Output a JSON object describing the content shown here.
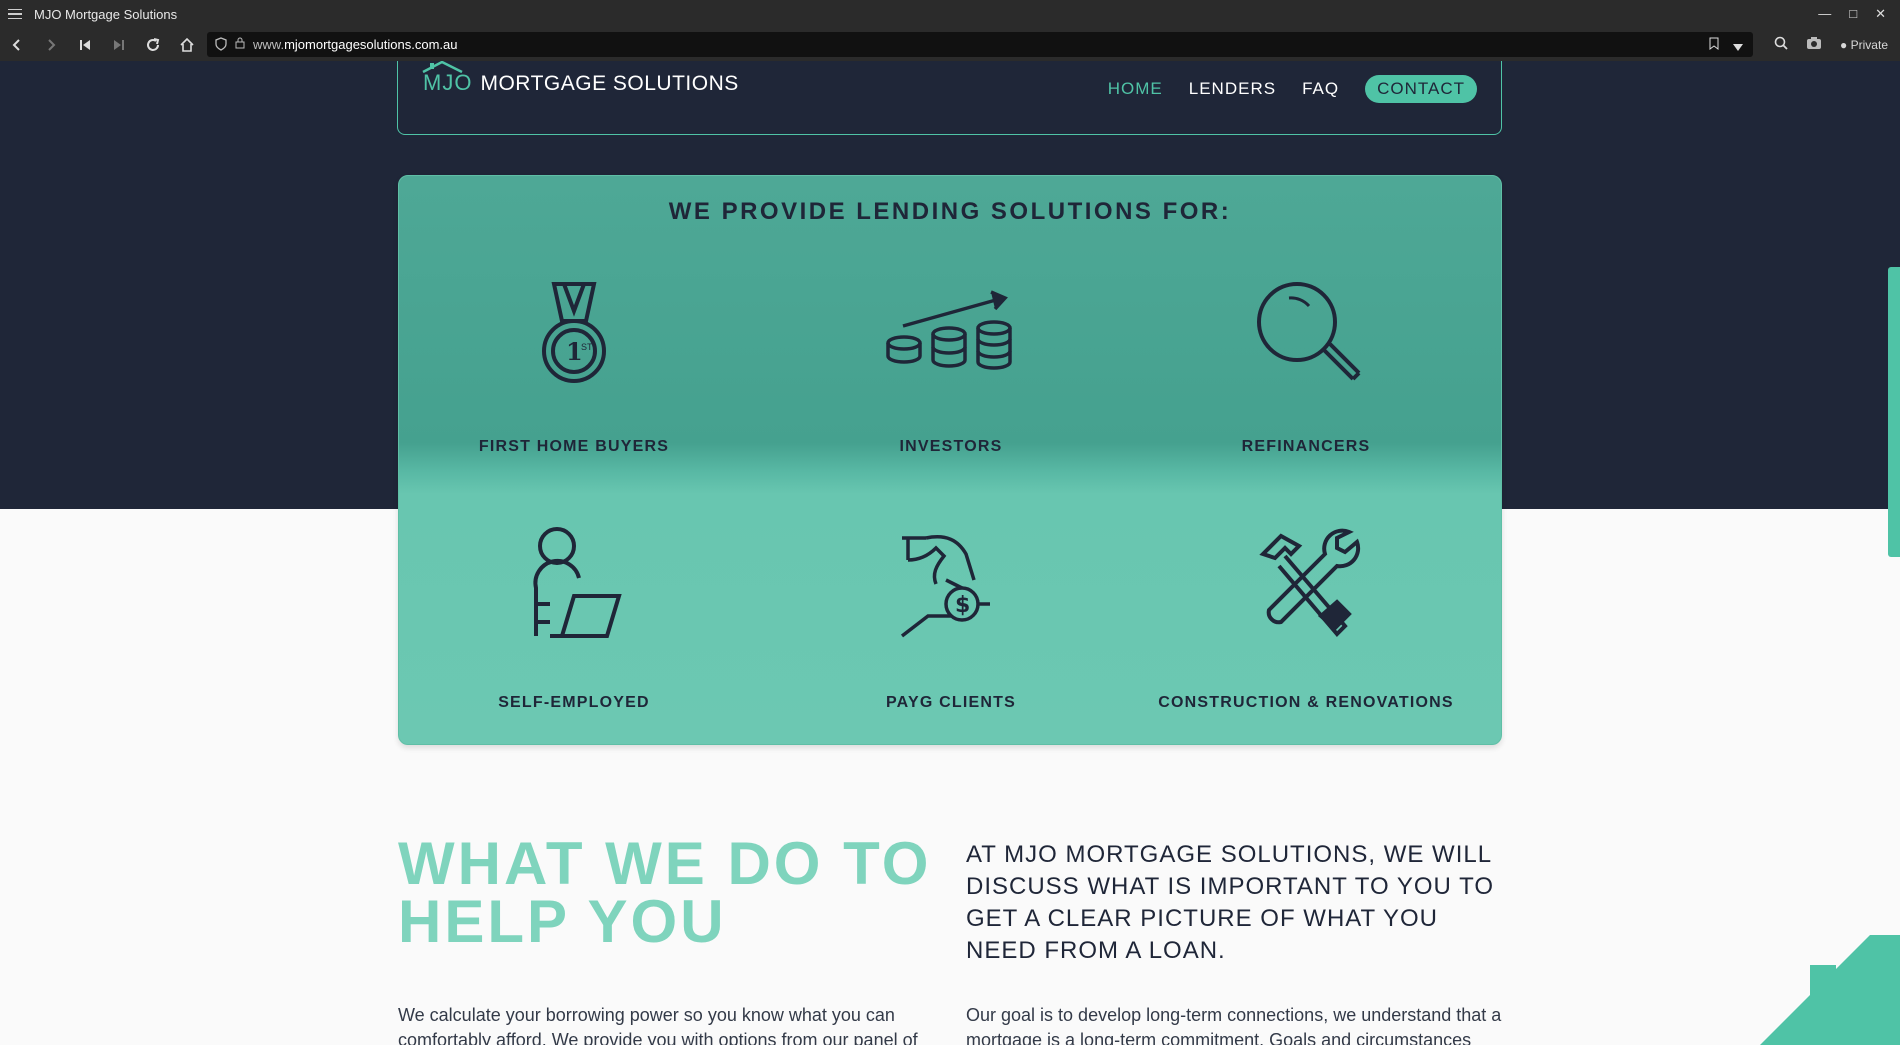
{
  "browser": {
    "window_title": "MJO Mortgage Solutions",
    "url_prefix": "www.",
    "url_host": "mjomortgagesolutions.com.au",
    "private_label": "Private"
  },
  "nav": {
    "logo_mjo": "MJO",
    "logo_rest": "MORTGAGE SOLUTIONS",
    "links": [
      "HOME",
      "LENDERS",
      "FAQ",
      "CONTACT"
    ]
  },
  "lending": {
    "heading": "WE PROVIDE LENDING SOLUTIONS FOR:",
    "items": [
      {
        "label": "FIRST HOME BUYERS",
        "icon": "medal-icon"
      },
      {
        "label": "INVESTORS",
        "icon": "coins-growth-icon"
      },
      {
        "label": "REFINANCERS",
        "icon": "magnifier-icon"
      },
      {
        "label": "SELF-EMPLOYED",
        "icon": "person-laptop-icon"
      },
      {
        "label": "PAYG CLIENTS",
        "icon": "hand-coin-icon"
      },
      {
        "label": "CONSTRUCTION & RENOVATIONS",
        "icon": "tools-icon"
      }
    ]
  },
  "what": {
    "title_line1": "WHAT WE DO TO",
    "title_line2": "HELP YOU",
    "quote": "AT MJO MORTGAGE SOLUTIONS, WE WILL DISCUSS WHAT IS IMPORTANT TO YOU TO GET A CLEAR PICTURE OF WHAT YOU NEED FROM A LOAN.",
    "left_para": "We calculate your borrowing power so you know what you can comfortably afford. We provide you with options from our panel of",
    "right_para": "Our goal is to develop long-term connections, we understand that a mortgage is a long-term commitment. Goals and circumstances"
  },
  "colors": {
    "navy": "#1f2638",
    "teal": "#4fc3a6",
    "mint": "#7fd4bd"
  }
}
